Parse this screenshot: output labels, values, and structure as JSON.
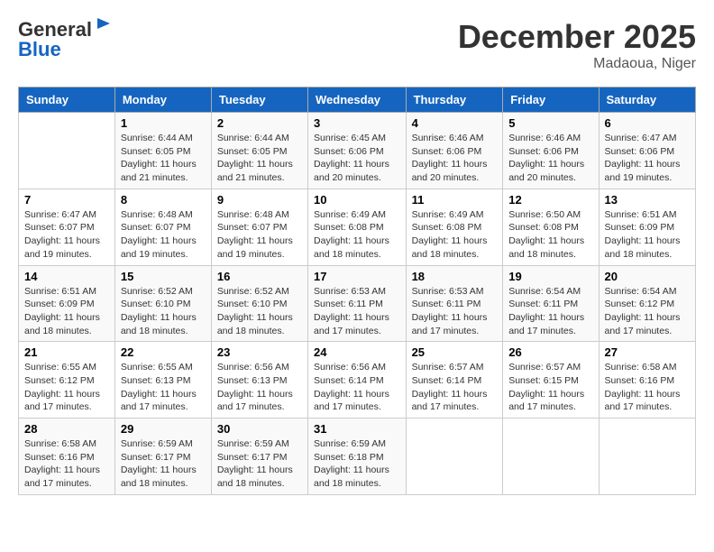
{
  "header": {
    "logo_line1": "General",
    "logo_line2": "Blue",
    "month": "December 2025",
    "location": "Madaoua, Niger"
  },
  "days_of_week": [
    "Sunday",
    "Monday",
    "Tuesday",
    "Wednesday",
    "Thursday",
    "Friday",
    "Saturday"
  ],
  "weeks": [
    [
      {
        "num": "",
        "detail": ""
      },
      {
        "num": "1",
        "detail": "Sunrise: 6:44 AM\nSunset: 6:05 PM\nDaylight: 11 hours and 21 minutes."
      },
      {
        "num": "2",
        "detail": "Sunrise: 6:44 AM\nSunset: 6:05 PM\nDaylight: 11 hours and 21 minutes."
      },
      {
        "num": "3",
        "detail": "Sunrise: 6:45 AM\nSunset: 6:06 PM\nDaylight: 11 hours and 20 minutes."
      },
      {
        "num": "4",
        "detail": "Sunrise: 6:46 AM\nSunset: 6:06 PM\nDaylight: 11 hours and 20 minutes."
      },
      {
        "num": "5",
        "detail": "Sunrise: 6:46 AM\nSunset: 6:06 PM\nDaylight: 11 hours and 20 minutes."
      },
      {
        "num": "6",
        "detail": "Sunrise: 6:47 AM\nSunset: 6:06 PM\nDaylight: 11 hours and 19 minutes."
      }
    ],
    [
      {
        "num": "7",
        "detail": "Sunrise: 6:47 AM\nSunset: 6:07 PM\nDaylight: 11 hours and 19 minutes."
      },
      {
        "num": "8",
        "detail": "Sunrise: 6:48 AM\nSunset: 6:07 PM\nDaylight: 11 hours and 19 minutes."
      },
      {
        "num": "9",
        "detail": "Sunrise: 6:48 AM\nSunset: 6:07 PM\nDaylight: 11 hours and 19 minutes."
      },
      {
        "num": "10",
        "detail": "Sunrise: 6:49 AM\nSunset: 6:08 PM\nDaylight: 11 hours and 18 minutes."
      },
      {
        "num": "11",
        "detail": "Sunrise: 6:49 AM\nSunset: 6:08 PM\nDaylight: 11 hours and 18 minutes."
      },
      {
        "num": "12",
        "detail": "Sunrise: 6:50 AM\nSunset: 6:08 PM\nDaylight: 11 hours and 18 minutes."
      },
      {
        "num": "13",
        "detail": "Sunrise: 6:51 AM\nSunset: 6:09 PM\nDaylight: 11 hours and 18 minutes."
      }
    ],
    [
      {
        "num": "14",
        "detail": "Sunrise: 6:51 AM\nSunset: 6:09 PM\nDaylight: 11 hours and 18 minutes."
      },
      {
        "num": "15",
        "detail": "Sunrise: 6:52 AM\nSunset: 6:10 PM\nDaylight: 11 hours and 18 minutes."
      },
      {
        "num": "16",
        "detail": "Sunrise: 6:52 AM\nSunset: 6:10 PM\nDaylight: 11 hours and 18 minutes."
      },
      {
        "num": "17",
        "detail": "Sunrise: 6:53 AM\nSunset: 6:11 PM\nDaylight: 11 hours and 17 minutes."
      },
      {
        "num": "18",
        "detail": "Sunrise: 6:53 AM\nSunset: 6:11 PM\nDaylight: 11 hours and 17 minutes."
      },
      {
        "num": "19",
        "detail": "Sunrise: 6:54 AM\nSunset: 6:11 PM\nDaylight: 11 hours and 17 minutes."
      },
      {
        "num": "20",
        "detail": "Sunrise: 6:54 AM\nSunset: 6:12 PM\nDaylight: 11 hours and 17 minutes."
      }
    ],
    [
      {
        "num": "21",
        "detail": "Sunrise: 6:55 AM\nSunset: 6:12 PM\nDaylight: 11 hours and 17 minutes."
      },
      {
        "num": "22",
        "detail": "Sunrise: 6:55 AM\nSunset: 6:13 PM\nDaylight: 11 hours and 17 minutes."
      },
      {
        "num": "23",
        "detail": "Sunrise: 6:56 AM\nSunset: 6:13 PM\nDaylight: 11 hours and 17 minutes."
      },
      {
        "num": "24",
        "detail": "Sunrise: 6:56 AM\nSunset: 6:14 PM\nDaylight: 11 hours and 17 minutes."
      },
      {
        "num": "25",
        "detail": "Sunrise: 6:57 AM\nSunset: 6:14 PM\nDaylight: 11 hours and 17 minutes."
      },
      {
        "num": "26",
        "detail": "Sunrise: 6:57 AM\nSunset: 6:15 PM\nDaylight: 11 hours and 17 minutes."
      },
      {
        "num": "27",
        "detail": "Sunrise: 6:58 AM\nSunset: 6:16 PM\nDaylight: 11 hours and 17 minutes."
      }
    ],
    [
      {
        "num": "28",
        "detail": "Sunrise: 6:58 AM\nSunset: 6:16 PM\nDaylight: 11 hours and 17 minutes."
      },
      {
        "num": "29",
        "detail": "Sunrise: 6:59 AM\nSunset: 6:17 PM\nDaylight: 11 hours and 18 minutes."
      },
      {
        "num": "30",
        "detail": "Sunrise: 6:59 AM\nSunset: 6:17 PM\nDaylight: 11 hours and 18 minutes."
      },
      {
        "num": "31",
        "detail": "Sunrise: 6:59 AM\nSunset: 6:18 PM\nDaylight: 11 hours and 18 minutes."
      },
      {
        "num": "",
        "detail": ""
      },
      {
        "num": "",
        "detail": ""
      },
      {
        "num": "",
        "detail": ""
      }
    ]
  ]
}
